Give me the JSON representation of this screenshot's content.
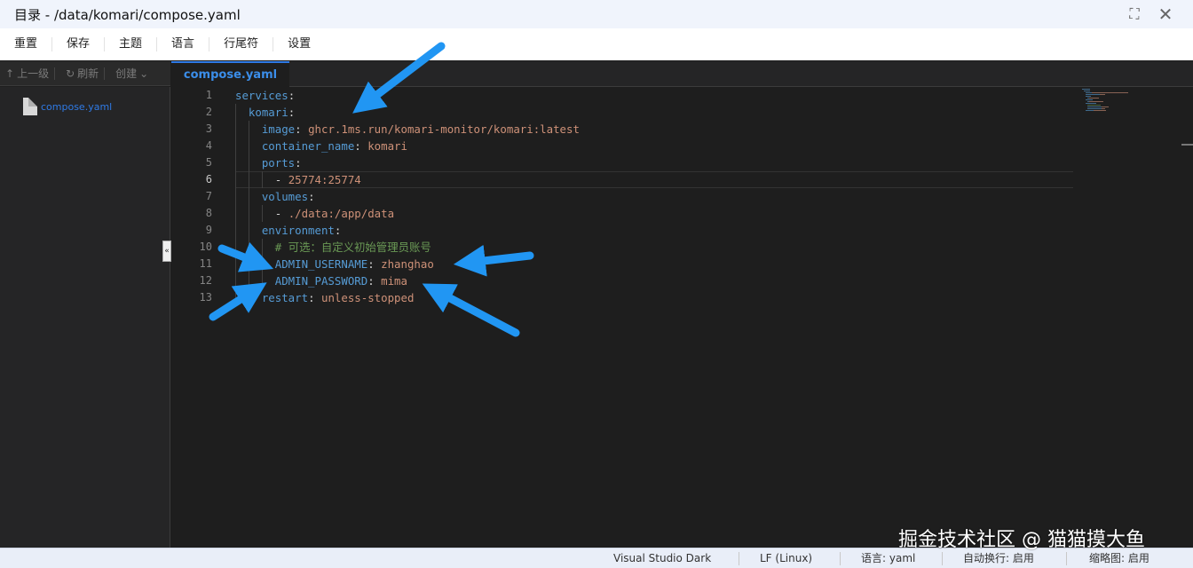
{
  "window": {
    "title": "目录 - /data/komari/compose.yaml"
  },
  "menu": [
    "重置",
    "保存",
    "主题",
    "语言",
    "行尾符",
    "设置"
  ],
  "toolbar": {
    "up": "上一级",
    "refresh": "刷新",
    "create": "创建"
  },
  "sidebar": {
    "files": [
      "compose.yaml"
    ]
  },
  "tab": {
    "label": "compose.yaml"
  },
  "editor": {
    "current_line": 6,
    "lines": [
      {
        "num": "1",
        "tokens": [
          {
            "t": "services",
            "c": "k"
          },
          {
            "t": ":",
            "c": "p"
          }
        ]
      },
      {
        "num": "2",
        "tokens": [
          {
            "t": "  komari",
            "c": "k"
          },
          {
            "t": ":",
            "c": "p"
          }
        ]
      },
      {
        "num": "3",
        "tokens": [
          {
            "t": "    image",
            "c": "k"
          },
          {
            "t": ": ",
            "c": "p"
          },
          {
            "t": "ghcr.1ms.run/komari-monitor/komari:latest",
            "c": "s"
          }
        ]
      },
      {
        "num": "4",
        "tokens": [
          {
            "t": "    container_name",
            "c": "k"
          },
          {
            "t": ": ",
            "c": "p"
          },
          {
            "t": "komari",
            "c": "s"
          }
        ]
      },
      {
        "num": "5",
        "tokens": [
          {
            "t": "    ports",
            "c": "k"
          },
          {
            "t": ":",
            "c": "p"
          }
        ]
      },
      {
        "num": "6",
        "tokens": [
          {
            "t": "      - ",
            "c": "p"
          },
          {
            "t": "25774:25774",
            "c": "s"
          }
        ]
      },
      {
        "num": "7",
        "tokens": [
          {
            "t": "    volumes",
            "c": "k"
          },
          {
            "t": ":",
            "c": "p"
          }
        ]
      },
      {
        "num": "8",
        "tokens": [
          {
            "t": "      - ",
            "c": "p"
          },
          {
            "t": "./data:/app/data",
            "c": "s"
          }
        ]
      },
      {
        "num": "9",
        "tokens": [
          {
            "t": "    environment",
            "c": "k"
          },
          {
            "t": ":",
            "c": "p"
          }
        ]
      },
      {
        "num": "10",
        "tokens": [
          {
            "t": "      # 可选：自定义初始管理员账号",
            "c": "c"
          }
        ]
      },
      {
        "num": "11",
        "tokens": [
          {
            "t": "      ADMIN_USERNAME",
            "c": "k"
          },
          {
            "t": ": ",
            "c": "p"
          },
          {
            "t": "zhanghao",
            "c": "s"
          }
        ]
      },
      {
        "num": "12",
        "tokens": [
          {
            "t": "      ADMIN_PASSWORD",
            "c": "k"
          },
          {
            "t": ": ",
            "c": "p"
          },
          {
            "t": "mima",
            "c": "s"
          }
        ]
      },
      {
        "num": "13",
        "tokens": [
          {
            "t": "    restart",
            "c": "k"
          },
          {
            "t": ": ",
            "c": "p"
          },
          {
            "t": "unless-stopped",
            "c": "s"
          }
        ]
      }
    ]
  },
  "status": {
    "theme": "Visual Studio Dark",
    "eol": "LF (Linux)",
    "language": "语言: yaml",
    "wrap": "自动换行: 启用",
    "minimap": "缩略图: 启用"
  },
  "watermark": "掘金技术社区 @ 猫猫摸大鱼",
  "colors": {
    "key": "#569cd6",
    "string": "#ce9178",
    "comment": "#6a9955",
    "arrow": "#2196f3",
    "tab_accent": "#2f7ae5"
  },
  "icons": {
    "maximize": "maximize-icon",
    "close": "close-icon",
    "up": "arrow-up-icon",
    "refresh": "refresh-icon",
    "create_dropdown": "chevron-down-icon",
    "file": "file-icon"
  }
}
